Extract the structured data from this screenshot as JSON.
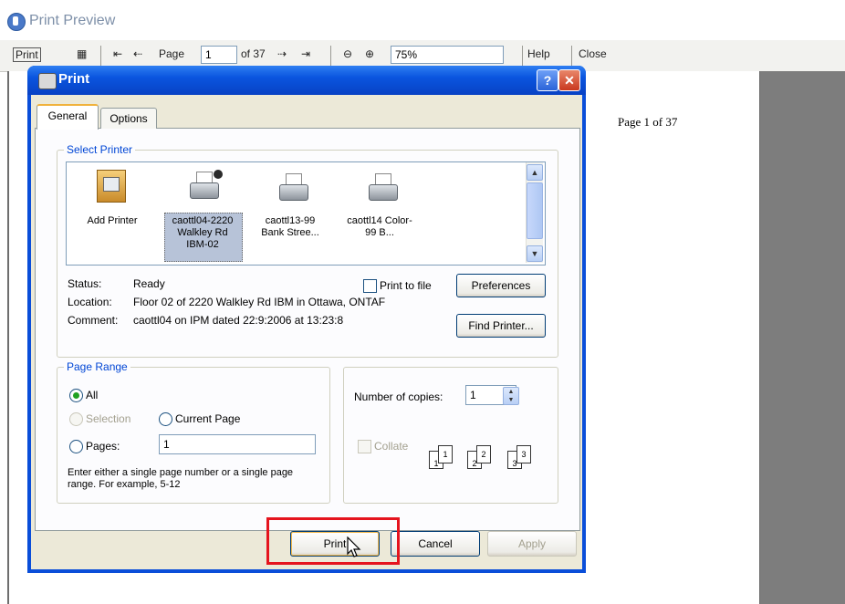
{
  "preview_window": {
    "title": "Print Preview",
    "toolbar": {
      "print_label": "Print",
      "page_label": "Page",
      "page_value": "1",
      "page_of": "of 37",
      "zoom_value": "75%",
      "help_label": "Help",
      "close_label": "Close"
    },
    "page_header_text": "Page 1 of 37"
  },
  "dialog": {
    "title": "Print",
    "help_glyph": "?",
    "close_glyph": "✕",
    "tabs": [
      "General",
      "Options"
    ],
    "select_printer": {
      "label": "Select Printer",
      "printers": [
        {
          "name": "Add Printer"
        },
        {
          "name": "caottl04-2220 Walkley Rd IBM-02",
          "selected": true
        },
        {
          "name": "caottl13-99 Bank Stree..."
        },
        {
          "name": "caottl14 Color-99 B..."
        }
      ],
      "status_label": "Status:",
      "status_value": "Ready",
      "location_label": "Location:",
      "location_value": "Floor 02 of 2220 Walkley Rd IBM in Ottawa, ONTAF",
      "comment_label": "Comment:",
      "comment_value": "caottl04 on IPM dated 22:9:2006 at 13:23:8",
      "print_to_file_label": "Print to file",
      "preferences_label": "Preferences",
      "find_printer_label": "Find Printer..."
    },
    "page_range": {
      "label": "Page Range",
      "all_label": "All",
      "selection_label": "Selection",
      "current_page_label": "Current Page",
      "pages_label": "Pages:",
      "pages_value": "1",
      "help_text": "Enter either a single page number or a single page range.  For example, 5-12"
    },
    "copies": {
      "number_label": "Number of copies:",
      "number_value": "1",
      "collate_label": "Collate",
      "collate_pages": [
        "1",
        "1",
        "2",
        "2",
        "3",
        "3"
      ]
    },
    "buttons": {
      "print": "Print",
      "cancel": "Cancel",
      "apply": "Apply"
    }
  },
  "colors": {
    "title_blue": "#0a4ed9",
    "highlight_red": "#e5141e",
    "group_label_blue": "#0046d5"
  }
}
